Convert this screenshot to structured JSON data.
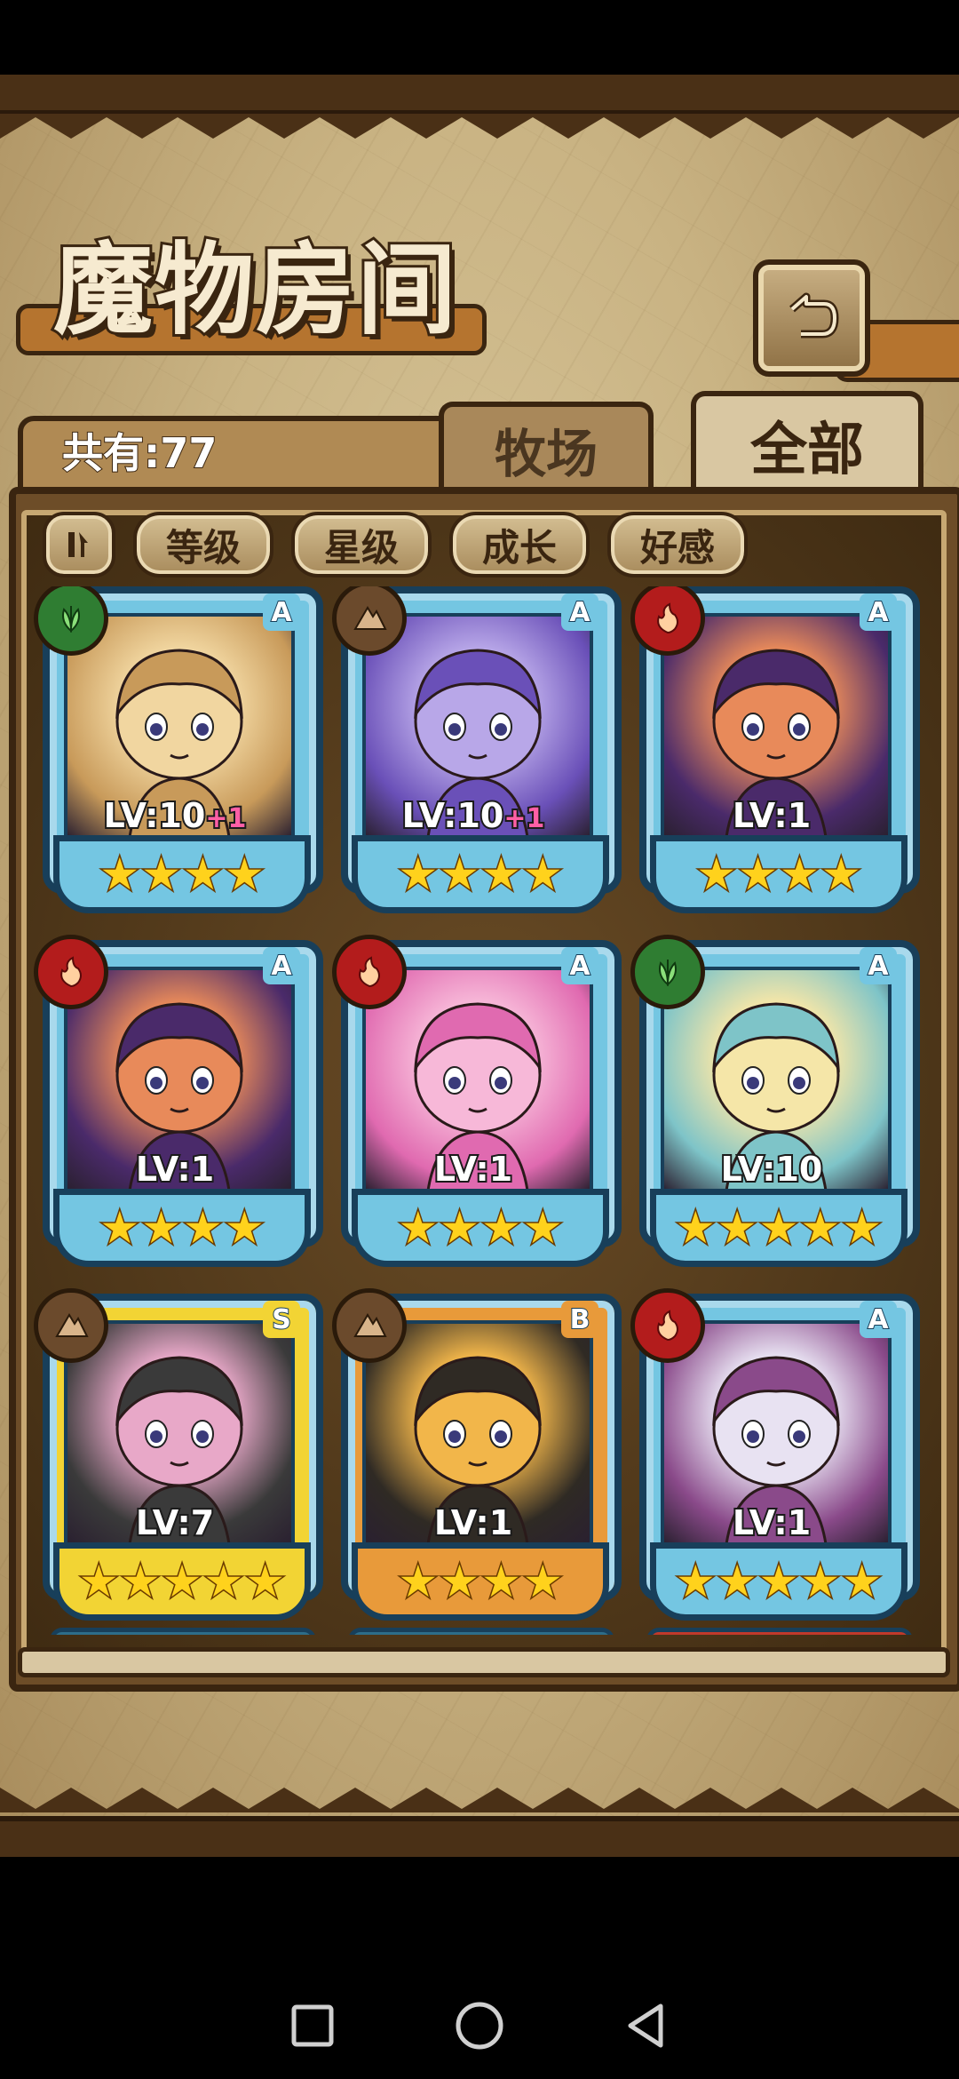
{
  "screen": {
    "title": "魔物房间"
  },
  "header": {
    "count_label": "共有:77"
  },
  "tabs": [
    {
      "label": "牧场"
    },
    {
      "label": "全部"
    }
  ],
  "sort": {
    "buttons": [
      {
        "label": "等级"
      },
      {
        "label": "星级"
      },
      {
        "label": "成长"
      },
      {
        "label": "好感"
      }
    ]
  },
  "monsters": [
    {
      "level": "LV:10",
      "bonus": "+1",
      "stars": 4,
      "element": "grass",
      "rank": "A",
      "frame": "blue",
      "art": [
        "#f1d6a0",
        "#c89a5a"
      ]
    },
    {
      "level": "LV:10",
      "bonus": "+1",
      "stars": 4,
      "element": "earth",
      "rank": "A",
      "frame": "blue",
      "art": [
        "#b8a7e8",
        "#6a50b8"
      ]
    },
    {
      "level": "LV:1",
      "bonus": "",
      "stars": 4,
      "element": "fire",
      "rank": "A",
      "frame": "blue",
      "art": [
        "#e88a5a",
        "#4a2a6a"
      ]
    },
    {
      "level": "LV:1",
      "bonus": "",
      "stars": 4,
      "element": "fire",
      "rank": "A",
      "frame": "blue",
      "art": [
        "#e88a5a",
        "#4a2a6a"
      ]
    },
    {
      "level": "LV:1",
      "bonus": "",
      "stars": 4,
      "element": "fire",
      "rank": "A",
      "frame": "blue",
      "art": [
        "#f7b8d8",
        "#e06ab0"
      ]
    },
    {
      "level": "LV:10",
      "bonus": "",
      "stars": 5,
      "element": "grass",
      "rank": "A",
      "frame": "blue",
      "art": [
        "#f5e6a8",
        "#7ec4c8"
      ]
    },
    {
      "level": "LV:7",
      "bonus": "",
      "stars": 5,
      "element": "earth",
      "rank": "S",
      "frame": "gold",
      "art": [
        "#e8a8c8",
        "#3a3a3a"
      ]
    },
    {
      "level": "LV:1",
      "bonus": "",
      "stars": 4,
      "element": "earth",
      "rank": "B",
      "frame": "orange",
      "art": [
        "#f2b64a",
        "#2f2a24"
      ]
    },
    {
      "level": "LV:1",
      "bonus": "",
      "stars": 5,
      "element": "fire",
      "rank": "A",
      "frame": "blue",
      "art": [
        "#e8e2f2",
        "#8a4a8a"
      ]
    }
  ],
  "colors": {
    "grass": "#2f7d32",
    "earth": "#6b4a2c",
    "fire": "#b31c1c",
    "blue": "#74c6e2",
    "gold": "#f2d434",
    "orange": "#e89a3a"
  },
  "icons": {
    "back": "undo-arrow-icon",
    "toggle": "sort-toggle-icon",
    "nav": [
      "square-icon",
      "circle-icon",
      "triangle-back-icon"
    ]
  }
}
